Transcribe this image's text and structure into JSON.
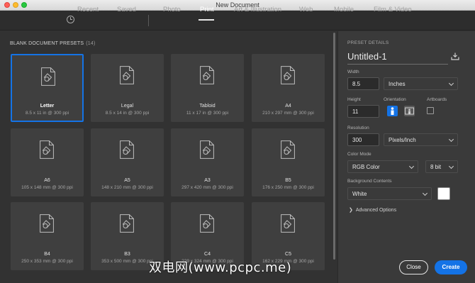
{
  "window": {
    "title": "New Document"
  },
  "tabs": [
    {
      "label": "Recent",
      "icon": "clock-icon"
    },
    {
      "label": "Saved"
    },
    {
      "label": "Photo"
    },
    {
      "label": "Print",
      "active": true
    },
    {
      "label": "Art & Illustration"
    },
    {
      "label": "Web"
    },
    {
      "label": "Mobile"
    },
    {
      "label": "Film & Video"
    }
  ],
  "presets": {
    "header": "BLANK DOCUMENT PRESETS",
    "count": "(14)",
    "items": [
      {
        "name": "Letter",
        "size": "8.5 x 11 in @ 300 ppi",
        "selected": true
      },
      {
        "name": "Legal",
        "size": "8.5 x 14 in @ 300 ppi"
      },
      {
        "name": "Tabloid",
        "size": "11 x 17 in @ 300 ppi"
      },
      {
        "name": "A4",
        "size": "210 x 297 mm @ 300 ppi"
      },
      {
        "name": "A6",
        "size": "105 x 148 mm @ 300 ppi"
      },
      {
        "name": "A5",
        "size": "148 x 210 mm @ 300 ppi"
      },
      {
        "name": "A3",
        "size": "297 x 420 mm @ 300 ppi"
      },
      {
        "name": "B5",
        "size": "176 x 250 mm @ 300 ppi"
      },
      {
        "name": "B4",
        "size": "250 x 353 mm @ 300 ppi"
      },
      {
        "name": "B3",
        "size": "353 x 500 mm @ 300 ppi"
      },
      {
        "name": "C4",
        "size": "229 x 324 mm @ 300 ppi"
      },
      {
        "name": "C5",
        "size": "162 x 229 mm @ 300 ppi"
      }
    ]
  },
  "details": {
    "title": "PRESET DETAILS",
    "doc_name": "Untitled-1",
    "width_label": "Width",
    "width_value": "8.5",
    "width_unit": "Inches",
    "height_label": "Height",
    "height_value": "11",
    "orientation_label": "Orientation",
    "artboards_label": "Artboards",
    "resolution_label": "Resolution",
    "resolution_value": "300",
    "resolution_unit": "Pixels/Inch",
    "color_mode_label": "Color Mode",
    "color_mode_value": "RGB Color",
    "bit_depth_value": "8 bit",
    "background_label": "Background Contents",
    "background_value": "White",
    "background_color": "#ffffff",
    "advanced_label": "Advanced Options",
    "close_label": "Close",
    "create_label": "Create"
  },
  "colors": {
    "accent": "#1473e6",
    "panel": "#323232",
    "card": "#3f3f3f"
  },
  "watermark": "双电网(www.pcpc.me)"
}
